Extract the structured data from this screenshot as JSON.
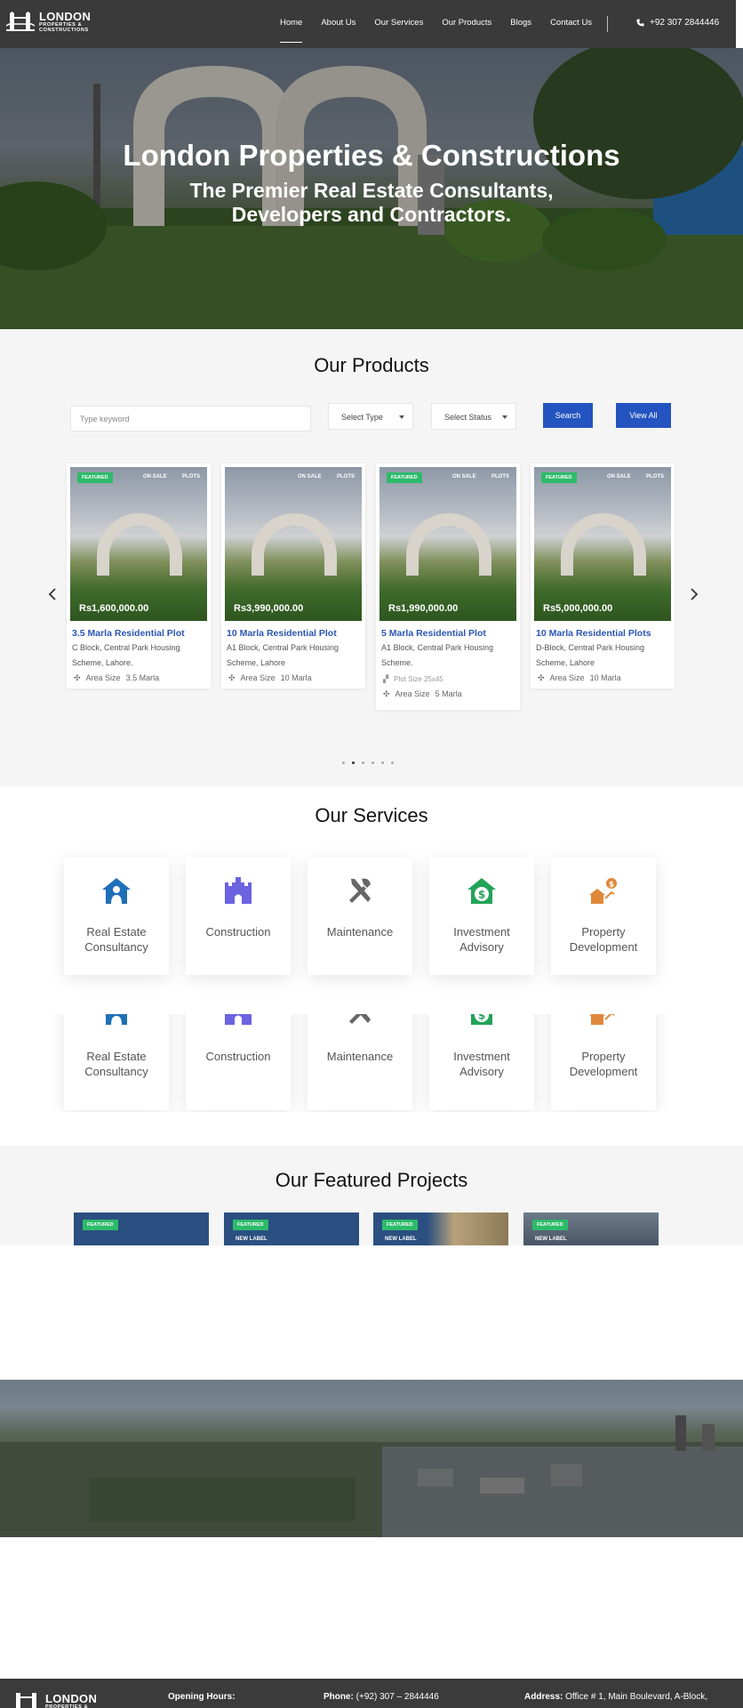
{
  "header": {
    "logo_main": "LONDON",
    "logo_sub": "PROPERTIES &",
    "logo_sub2": "CONSTRUCTIONS",
    "nav": [
      "Home",
      "About Us",
      "Our Services",
      "Our Products",
      "Blogs",
      "Contact Us"
    ],
    "phone": "+92 307 2844446"
  },
  "hero": {
    "title": "London Properties & Constructions",
    "subtitle": "The Premier Real Estate Consultants, Developers and Contractors."
  },
  "products": {
    "title": "Our Products",
    "search_placeholder": "Type keyword",
    "select_type": "Select Type",
    "select_status": "Select Status",
    "search_label": "Search",
    "view_all_label": "View All",
    "prev_icon": "chevron-left-icon",
    "next_icon": "chevron-right-icon",
    "cards": [
      {
        "featured": "FEATURED",
        "sale": "ON SALE",
        "type": "PLOTS",
        "price": "Rs1,600,000.00",
        "title": "3.5 Marla Residential Plot",
        "address": "C Block, Central Park Housing Scheme, Lahore.",
        "area_label": "Area Size",
        "area": "3.5 Marla"
      },
      {
        "featured": "",
        "sale": "ON SALE",
        "type": "PLOTS",
        "price": "Rs3,990,000.00",
        "title": "10 Marla Residential Plot",
        "address": "A1 Block, Central Park Housing Scheme, Lahore",
        "area_label": "Area Size",
        "area": "10 Marla"
      },
      {
        "featured": "FEATURED",
        "sale": "ON SALE",
        "type": "PLOTS",
        "price": "Rs1,990,000.00",
        "title": "5 Marla Residential Plot",
        "address": "A1 Block, Central Park Housing Scheme.",
        "plot_size": "Plot Size 25x45",
        "area_label": "Area Size",
        "area": "5 Marla"
      },
      {
        "featured": "FEATURED",
        "sale": "ON SALE",
        "type": "PLOTS",
        "price": "Rs5,000,000.00",
        "title": "10 Marla Residential Plots",
        "address": "D-Block, Central Park Housing Scheme, Lahore",
        "area_label": "Area Size",
        "area": "10 Marla"
      }
    ],
    "slider_pages": 6,
    "slider_active": 2
  },
  "services": {
    "title": "Our Services",
    "items": [
      {
        "label": "Real Estate Consultancy",
        "icon": "house-person-icon",
        "color": "#1f6fb8"
      },
      {
        "label": "Construction",
        "icon": "castle-icon",
        "color": "#6b63e0"
      },
      {
        "label": "Maintenance",
        "icon": "tools-icon",
        "color": "#666666"
      },
      {
        "label": "Investment Advisory",
        "icon": "dollar-house-icon",
        "color": "#23a35a"
      },
      {
        "label": "Property Development",
        "icon": "property-growth-icon",
        "color": "#e0883a"
      }
    ]
  },
  "featured": {
    "title": "Our Featured Projects",
    "cards": [
      {
        "badge": "FEATURED",
        "label": ""
      },
      {
        "badge": "FEATURED",
        "label": "NEW LABEL"
      },
      {
        "badge": "FEATURED",
        "label": "NEW LABEL"
      },
      {
        "badge": "FEATURED",
        "label": "NEW LABEL"
      }
    ]
  },
  "footer": {
    "opening_label": "Opening Hours:",
    "phone_label": "Phone:",
    "phone": "(+92) 307 – 2844446",
    "address_label": "Address:",
    "address": "Office # 1, Main Boulevard, A-Block,"
  },
  "colors": {
    "header_bg": "#3a3a3a",
    "accent_blue": "#2454c0",
    "featured_green": "#2dbb6a",
    "title_blue": "#2b55b4"
  }
}
